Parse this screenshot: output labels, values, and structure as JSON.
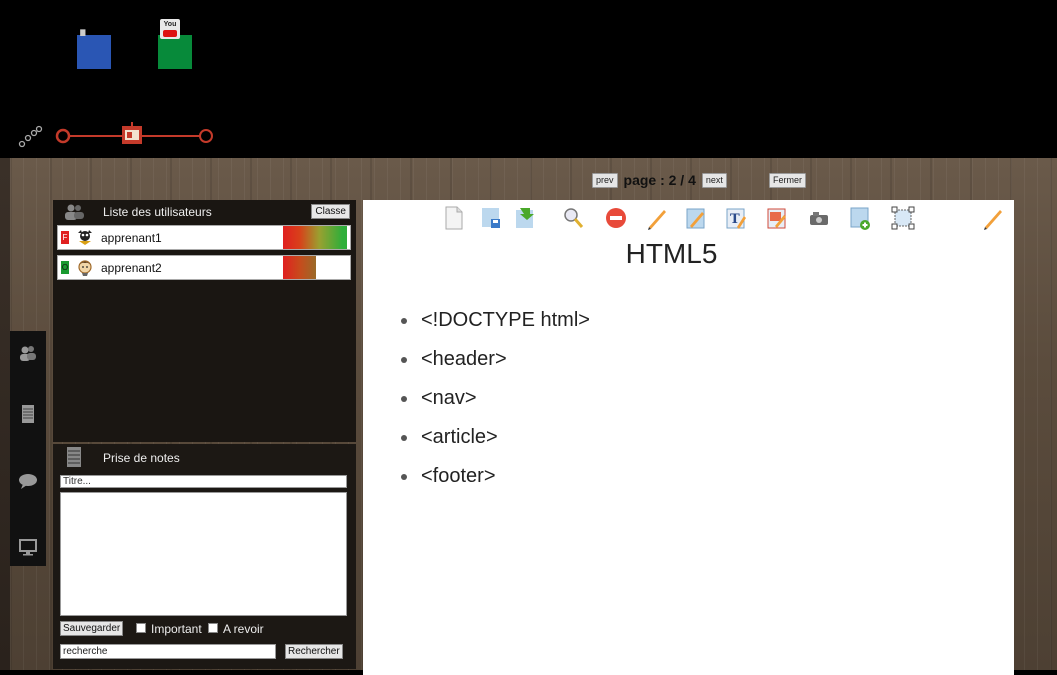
{
  "dock": {
    "blue_icon": "dock-app-icon",
    "green_icon": "youtube-icon",
    "youtube_text": "You"
  },
  "timeline": {
    "icon": "network-nodes-icon",
    "current": "presentation-icon"
  },
  "pagination": {
    "prev": "prev",
    "label": "page : 2 / 4",
    "next": "next",
    "close": "Fermer"
  },
  "users_panel": {
    "title": "Liste des utilisateurs",
    "class_button": "Classe",
    "users": [
      {
        "flag": "F",
        "flag_color": "#e02020",
        "name": "apprenant1",
        "avatar": "user-avatar-icon"
      },
      {
        "flag": "O",
        "flag_color": "#1a9a30",
        "name": "apprenant2",
        "avatar": "user-avatar-icon"
      }
    ]
  },
  "notes_panel": {
    "title": "Prise de notes",
    "title_placeholder": "Titre...",
    "save": "Sauvegarder",
    "important": "Important",
    "review": "A revoir",
    "search_value": "recherche",
    "search_button": "Rechercher"
  },
  "side_tools": [
    "users-icon",
    "notepad-icon",
    "chat-icon",
    "screen-icon"
  ],
  "slide": {
    "title": "HTML5",
    "items": [
      "<!DOCTYPE html>",
      "<header>",
      "<nav>",
      "<article>",
      "<footer>"
    ],
    "tools": [
      "new-page-icon",
      "save-icon",
      "import-icon",
      "zoom-icon",
      "stop-icon",
      "pencil-icon",
      "edit-icon",
      "text-icon",
      "highlight-icon",
      "camera-icon",
      "add-icon",
      "select-icon",
      "draw-icon"
    ]
  }
}
